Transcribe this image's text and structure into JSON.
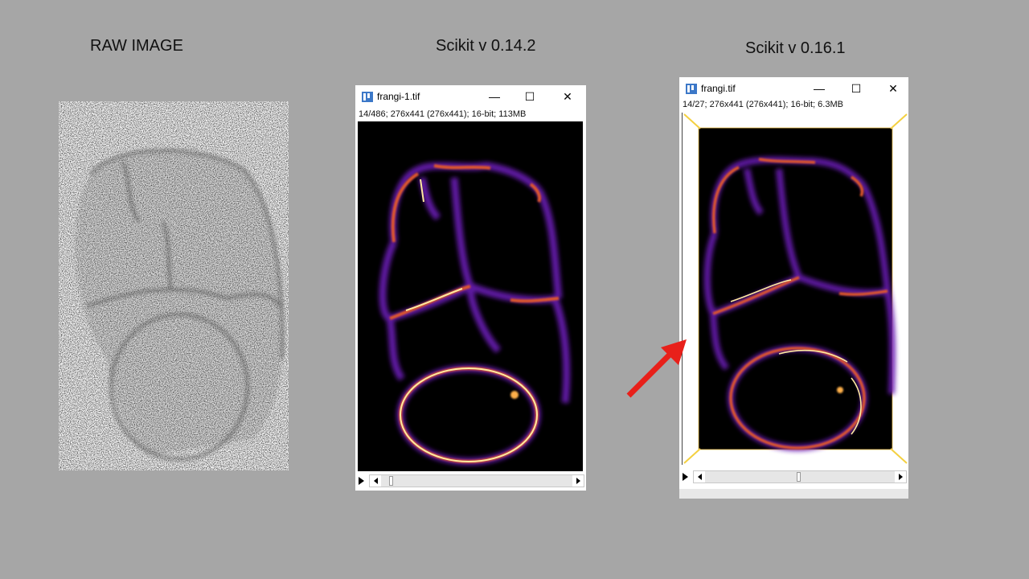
{
  "headings": {
    "raw": "RAW IMAGE",
    "v014": "Scikit v 0.14.2",
    "v016": "Scikit v 0.16.1"
  },
  "window_v014": {
    "title": "frangi-1.tif",
    "info": "14/486; 276x441   (276x441); 16-bit; 113MB",
    "slice_position": 0.03
  },
  "window_v016": {
    "title": "frangi.tif",
    "info": "14/27; 276x441   (276x441); 16-bit; 6.3MB",
    "slice_position": 0.5
  },
  "window_buttons": {
    "minimize": "—",
    "maximize": "☐",
    "close": "✕"
  },
  "colors": {
    "slide_background": "#a6a6a6",
    "arrow": "#e8201a",
    "border_artifact": "#ffffff",
    "corner_artifact": "#ffd84a"
  },
  "icons": [
    "imagej-window-icon",
    "play-icon",
    "scroll-left-icon",
    "scroll-right-icon",
    "red-arrow-icon"
  ]
}
